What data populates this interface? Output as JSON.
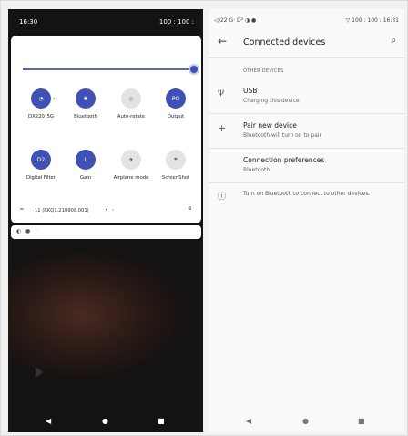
{
  "left_phone": {
    "status": {
      "time": "16:30",
      "battery": "100 : 100 :"
    },
    "tiles": [
      {
        "label": "DX220_5G",
        "icon": "wifi-icon",
        "glyph": "◔",
        "on": true,
        "chevron": "›"
      },
      {
        "label": "Bluetooth",
        "icon": "bluetooth-icon",
        "glyph": "✱",
        "on": true
      },
      {
        "label": "Auto-rotate",
        "icon": "rotate-icon",
        "glyph": "◇",
        "on": false
      },
      {
        "label": "Output",
        "icon": "output-icon",
        "glyph": "PO",
        "on": true
      },
      {
        "label": "Digital Filter",
        "icon": "filter-icon",
        "glyph": "D2",
        "on": true
      },
      {
        "label": "Gain",
        "icon": "gain-icon",
        "glyph": "L",
        "on": true
      },
      {
        "label": "Airplane mode",
        "icon": "airplane-icon",
        "glyph": "✈",
        "on": false
      },
      {
        "label": "ScreenShot",
        "icon": "crop-icon",
        "glyph": "⌗",
        "on": false
      }
    ],
    "footer": {
      "build": "11 (RKQ1.210908.001)",
      "page_dots": "• ◦",
      "pencil": "✏",
      "gear": "⚙"
    },
    "notification_icons": [
      "◐",
      "●",
      "·"
    ],
    "nav": {
      "back": "◀",
      "home": "●",
      "recents": "■"
    }
  },
  "right_phone": {
    "status": {
      "left": "◁)22  G· D²  ◑  ●",
      "right": "▽  100 : 100 : 16:31"
    },
    "appbar": {
      "back": "←",
      "title": "Connected devices",
      "search": "⌕"
    },
    "section_header": "OTHER DEVICES",
    "rows": [
      {
        "icon": "Ψ",
        "title": "USB",
        "subtitle": "Charging this device"
      },
      {
        "icon": "+",
        "title": "Pair new device",
        "subtitle": "Bluetooth will turn on to pair"
      },
      {
        "icon": "",
        "title": "Connection preferences",
        "subtitle": "Bluetooth"
      }
    ],
    "info": {
      "icon": "ⓘ",
      "text": "Turn on Bluetooth to connect to other devices."
    },
    "nav": {
      "back": "◀",
      "home": "●",
      "recents": "■"
    }
  }
}
